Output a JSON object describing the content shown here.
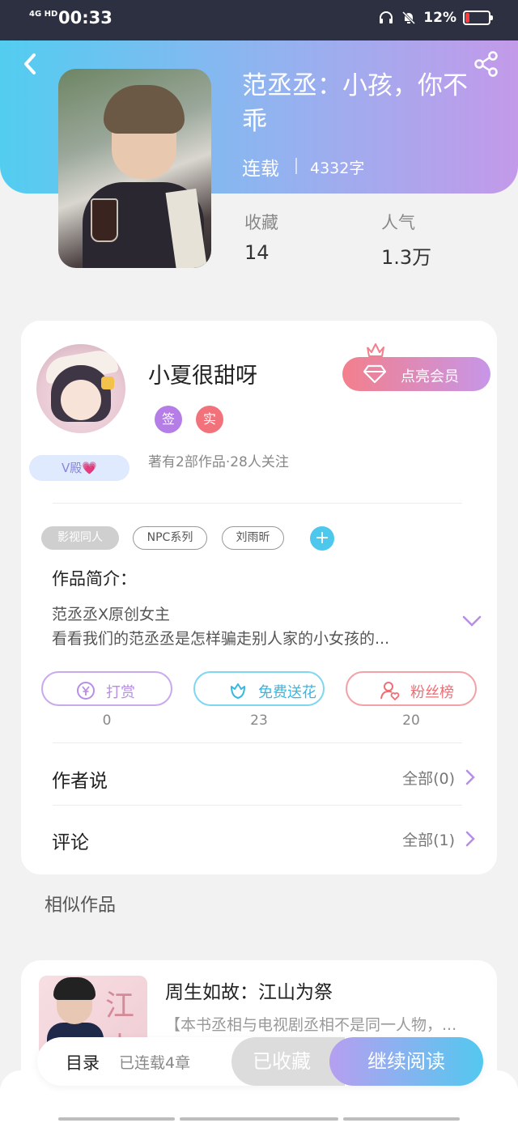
{
  "status_bar": {
    "network": "4G HD",
    "time": "00:33",
    "battery_pct": "12%"
  },
  "book": {
    "title": "范丞丞：小孩，你不乖",
    "status": "连载",
    "word_count": "4332字",
    "stats": [
      {
        "label": "收藏",
        "value": "14"
      },
      {
        "label": "人气",
        "value": "1.3万"
      }
    ]
  },
  "author": {
    "name": "小夏很甜呀",
    "badges": [
      "签",
      "实"
    ],
    "level_tag": "V殿💗",
    "meta": "著有2部作品·28人关注",
    "vip_button": "点亮会员"
  },
  "tags": [
    "影视同人",
    "NPC系列",
    "刘雨昕"
  ],
  "intro": {
    "heading": "作品简介：",
    "lines": [
      "范丞丞X原创女主",
      "看看我们的范丞丞是怎样骗走别人家的小女孩的..."
    ]
  },
  "actions": [
    {
      "label": "打赏",
      "count": "0",
      "color": "#b68ee6"
    },
    {
      "label": "免费送花",
      "count": "23",
      "color": "#4cc8ec"
    },
    {
      "label": "粉丝榜",
      "count": "20",
      "color": "#f07a80"
    }
  ],
  "rows": [
    {
      "title": "作者说",
      "all": "全部(0)"
    },
    {
      "title": "评论",
      "all": "全部(1)"
    }
  ],
  "similar": {
    "heading": "相似作品",
    "items": [
      {
        "title": "周生如故：江山为祭",
        "desc": "【本书丞相与电视剧丞相不是同一人物，...",
        "cover_char": "江山"
      }
    ]
  },
  "bottom_bar": {
    "toc": "目录",
    "toc_meta": "已连载4章",
    "collected": "已收藏",
    "continue": "继续阅读"
  },
  "colors": {
    "header_start": "#52cdf0",
    "header_end": "#c39aea",
    "accent_purple": "#b47ee6",
    "accent_red": "#f2727b",
    "accent_cyan": "#4dc8ec"
  }
}
